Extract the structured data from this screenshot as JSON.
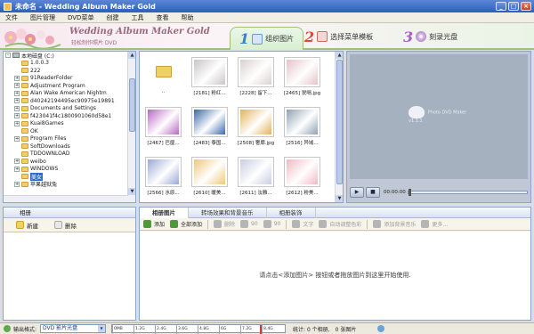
{
  "window": {
    "title": "未命名 - Wedding Album Maker Gold"
  },
  "menu": [
    "文件",
    "图片管理",
    "DVD菜单",
    "创建",
    "工具",
    "查看",
    "帮助"
  ],
  "banner": {
    "title": "Wedding Album Maker Gold",
    "subtitle": "轻松制作照片 DVD",
    "steps": [
      {
        "num": "1",
        "label": "组织图片"
      },
      {
        "num": "2",
        "label": "选择菜单模板"
      },
      {
        "num": "3",
        "label": "刻录光盘"
      }
    ]
  },
  "tree": {
    "items": [
      {
        "label": "本地磁盘 (C:)",
        "type": "drive",
        "depth": 0,
        "exp": "-"
      },
      {
        "label": "1.0.0.3",
        "type": "folder",
        "depth": 1,
        "exp": ""
      },
      {
        "label": "222",
        "type": "folder",
        "depth": 1,
        "exp": ""
      },
      {
        "label": "91ReaderFolder",
        "type": "folder",
        "depth": 1,
        "exp": "+"
      },
      {
        "label": "Adjustment Program",
        "type": "folder",
        "depth": 1,
        "exp": "+"
      },
      {
        "label": "Alan Wake American Nightm",
        "type": "folder",
        "depth": 1,
        "exp": "+"
      },
      {
        "label": "d40242194495ec90975e19891",
        "type": "folder",
        "depth": 1,
        "exp": "+"
      },
      {
        "label": "Documents and Settings",
        "type": "folder",
        "depth": 1,
        "exp": "+"
      },
      {
        "label": "f423041f4c1800901060d58e1",
        "type": "folder",
        "depth": 1,
        "exp": "+"
      },
      {
        "label": "Kuai8Games",
        "type": "folder",
        "depth": 1,
        "exp": "+"
      },
      {
        "label": "OK",
        "type": "folder",
        "depth": 1,
        "exp": ""
      },
      {
        "label": "Program Files",
        "type": "folder",
        "depth": 1,
        "exp": "+"
      },
      {
        "label": "SoftDownloads",
        "type": "folder",
        "depth": 1,
        "exp": ""
      },
      {
        "label": "TDDOWNLOAD",
        "type": "folder",
        "depth": 1,
        "exp": ""
      },
      {
        "label": "weibo",
        "type": "folder",
        "depth": 1,
        "exp": "+"
      },
      {
        "label": "WINDOWS",
        "type": "folder",
        "depth": 1,
        "exp": "+"
      },
      {
        "label": "美女",
        "type": "folder",
        "depth": 1,
        "exp": "",
        "selected": true
      },
      {
        "label": "苹果越狱兔",
        "type": "folder",
        "depth": 1,
        "exp": "+"
      }
    ]
  },
  "thumbnails": [
    {
      "caption": "..",
      "kind": "folder",
      "color": "#f2cf62"
    },
    {
      "caption": "[2181] 粉红...",
      "kind": "photo",
      "color": "#c9c5c8"
    },
    {
      "caption": "[2228] 留下...",
      "kind": "photo",
      "color": "#d9d2cf"
    },
    {
      "caption": "[2465] 猊嗝.jpg",
      "kind": "photo",
      "color": "#e6c3c8"
    },
    {
      "caption": "[2467] 巴厘...",
      "kind": "photo",
      "color": "#b967c4"
    },
    {
      "caption": "[2483] 泰国...",
      "kind": "photo",
      "color": "#3b6aa8"
    },
    {
      "caption": "[2508] 奢靡.jpg",
      "kind": "photo",
      "color": "#e3b35a"
    },
    {
      "caption": "[2516] 异域...",
      "kind": "photo",
      "color": "#8fa2b3"
    },
    {
      "caption": "[2566] 水原...",
      "kind": "photo",
      "color": "#9aa8d6"
    },
    {
      "caption": "[2610] 暖美...",
      "kind": "photo",
      "color": "#f0c779"
    },
    {
      "caption": "[2611] 淡雅...",
      "kind": "photo",
      "color": "#c8cde2"
    },
    {
      "caption": "[2612] 粉美...",
      "kind": "photo",
      "color": "#f1b9c4"
    }
  ],
  "preview": {
    "logo_text": "Photo DVD Maker v1.1.1",
    "play": "▶",
    "stop": "■",
    "time": "00:00:00"
  },
  "left_panel": {
    "header": "相册",
    "new_label": "新建",
    "delete_label": "删除"
  },
  "right_panel": {
    "tabs": [
      "相册图片",
      "转场效果和背景音乐",
      "相册装饰"
    ],
    "tools": [
      {
        "label": "添加",
        "enabled": true,
        "color": "#4e9a3a"
      },
      {
        "label": "全部添加",
        "enabled": true,
        "color": "#4e9a3a"
      },
      {
        "label": "删除",
        "enabled": false,
        "color": "#b5b5b5"
      },
      {
        "label": "90",
        "enabled": false,
        "color": "#b5b5b5"
      },
      {
        "label": "90",
        "enabled": false,
        "color": "#b5b5b5"
      },
      {
        "label": "文字",
        "enabled": false,
        "color": "#b5b5b5"
      },
      {
        "label": "自动调整色彩",
        "enabled": false,
        "color": "#b5b5b5"
      },
      {
        "label": "添加背景音乐",
        "enabled": false,
        "color": "#b5b5b5"
      },
      {
        "label": "更多...",
        "enabled": false,
        "color": "#b5b5b5"
      }
    ],
    "hint": "请点击<添加图片> 按钮或者拖放图片到这里开始使用."
  },
  "status": {
    "format_label": "输出格式:",
    "format_value": "DVD 影片光盘",
    "meter_ticks": [
      "0MB",
      "1.2G",
      "2.4G",
      "3.6G",
      "4.8G",
      "6G",
      "7.2G",
      "8.4G"
    ],
    "stats": "统计: 0 个相册,",
    "count": "0 张图片"
  },
  "colors": {
    "titlebar": "#2d5fb8",
    "banner_border": "#9cc27a",
    "selection": "#316ac5"
  }
}
